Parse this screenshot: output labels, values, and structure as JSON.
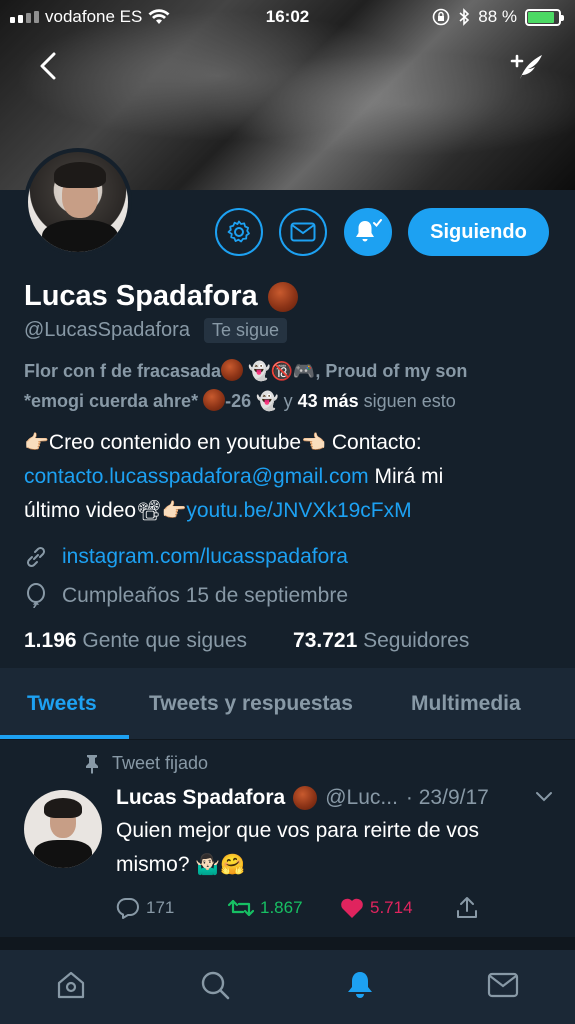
{
  "status_bar": {
    "carrier": "vodafone ES",
    "time": "16:02",
    "battery_percent": "88 %",
    "battery_level": 0.88
  },
  "header": {
    "back_icon": "chevron-left-icon",
    "compose_icon": "compose-tweet-icon"
  },
  "profile": {
    "name": "Lucas Spadafora",
    "handle": "@LucasSpadafora",
    "follows_you": "Te sigue",
    "common_followers": {
      "line1": "Flor con f de fracasada",
      "line1b": ", Proud of my son",
      "line2": "*emogi cuerda ahre*",
      "line2b": "-26",
      "conj": "y",
      "more": "43 más",
      "suffix": "siguen esto"
    },
    "bio": {
      "part1": "Creo contenido en youtube",
      "part2": "Contacto:",
      "email": "contacto.lucasspadafora@gmail.com",
      "part3": "Mirá mi",
      "part4": "último video",
      "youtube": "youtu.be/JNVXk19cFxM"
    },
    "website": "instagram.com/lucasspadafora",
    "birthday": "Cumpleaños 15 de septiembre",
    "following_count": "1.196",
    "following_label": "Gente que sigues",
    "followers_count": "73.721",
    "followers_label": "Seguidores",
    "following_button": "Siguiendo"
  },
  "tabs": [
    {
      "label": "Tweets",
      "active": true
    },
    {
      "label": "Tweets y respuestas",
      "active": false
    },
    {
      "label": "Multimedia",
      "active": false
    }
  ],
  "tweet": {
    "pinned_label": "Tweet fijado",
    "author": "Lucas Spadafora",
    "handle": "@Luc...",
    "date": "· 23/9/17",
    "text_line1": "Quien mejor que vos para reirte de vos",
    "text_line2": "mismo?",
    "replies": "171",
    "retweets": "1.867",
    "likes": "5.714"
  },
  "colors": {
    "background": "#15202b",
    "accent": "#1da1f2",
    "secondary_text": "#8899a6",
    "retweet": "#17bf63",
    "like": "#e0245e"
  }
}
